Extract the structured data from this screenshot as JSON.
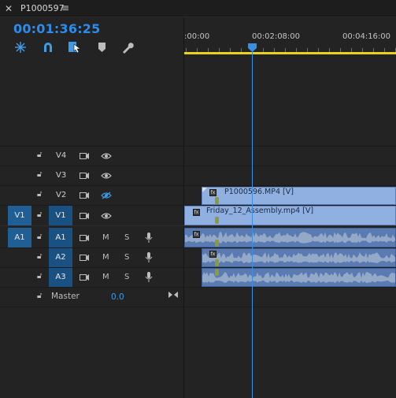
{
  "tab": {
    "close": "✕",
    "title": "P1000597",
    "menu": "≡"
  },
  "timecode": "00:01:36:25",
  "ruler": {
    "labels": [
      ":00:00",
      "00:02:08:00",
      "00:04:16:00"
    ]
  },
  "tracks": {
    "video": [
      {
        "name": "V4",
        "source": "",
        "eye_hidden": false
      },
      {
        "name": "V3",
        "source": "",
        "eye_hidden": false
      },
      {
        "name": "V2",
        "source": "",
        "eye_hidden": true
      },
      {
        "name": "V1",
        "source": "V1",
        "eye_hidden": false
      }
    ],
    "audio": [
      {
        "name": "A1",
        "source": "A1",
        "m": "M",
        "s": "S"
      },
      {
        "name": "A2",
        "source": "",
        "m": "M",
        "s": "S"
      },
      {
        "name": "A3",
        "source": "",
        "m": "M",
        "s": "S"
      }
    ],
    "master": {
      "label": "Master",
      "value": "0.0"
    }
  },
  "clips": {
    "v2": {
      "label": "P1000596.MP4 [V]",
      "fx": "fx"
    },
    "v1": {
      "label": "Friday_12_Assembly.mp4 [V]",
      "fx": "fx"
    }
  }
}
